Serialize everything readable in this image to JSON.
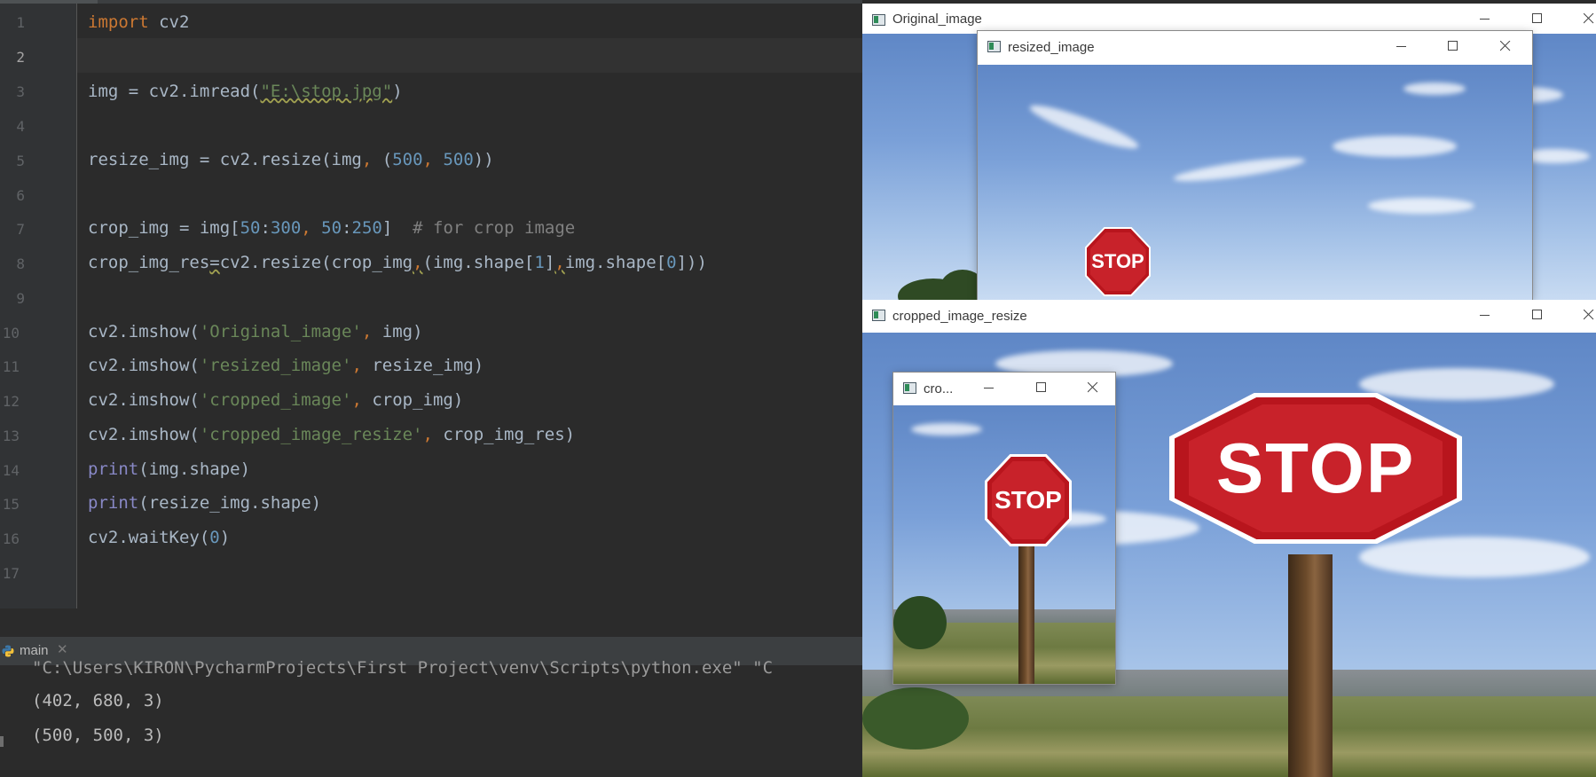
{
  "editor": {
    "current_line": 2,
    "lines": [
      {
        "n": "1"
      },
      {
        "n": "2"
      },
      {
        "n": "3"
      },
      {
        "n": "4"
      },
      {
        "n": "5"
      },
      {
        "n": "6"
      },
      {
        "n": "7"
      },
      {
        "n": "8"
      },
      {
        "n": "9"
      },
      {
        "n": "10"
      },
      {
        "n": "11"
      },
      {
        "n": "12"
      },
      {
        "n": "13"
      },
      {
        "n": "14"
      },
      {
        "n": "15"
      },
      {
        "n": "16"
      },
      {
        "n": "17"
      }
    ],
    "code": {
      "l1": {
        "kw": "import",
        "rest": " cv2"
      },
      "l3": {
        "a": "img = cv2.imread(",
        "s": "\"E:\\stop.jpg\"",
        "b": ")"
      },
      "l5": {
        "a": "resize_img = cv2.resize(img",
        "c1": ",",
        "sp": " (",
        "n1": "500",
        "c2": ",",
        "sp2": " ",
        "n2": "500",
        "b": "))"
      },
      "l7": {
        "a": "crop_img = img[",
        "n1": "50",
        "c1": ":",
        "n2": "300",
        "c2": ",",
        "sp": " ",
        "n3": "50",
        "c3": ":",
        "n4": "250",
        "b": "]  ",
        "cmt": "# for crop image"
      },
      "l8": {
        "a": "crop_img_res",
        "eq": "=",
        "b": "cv2.resize(crop_img",
        "c1": ",",
        "c": "(img.shape[",
        "n1": "1",
        "d": "]",
        "c2": ",",
        "e": "img.shape[",
        "n2": "0",
        "f": "]))"
      },
      "l10": {
        "a": "cv2.imshow(",
        "s": "'Original_image'",
        "c": ",",
        "b": " img)"
      },
      "l11": {
        "a": "cv2.imshow(",
        "s": "'resized_image'",
        "c": ",",
        "b": " resize_img)"
      },
      "l12": {
        "a": "cv2.imshow(",
        "s": "'cropped_image'",
        "c": ",",
        "b": " crop_img)"
      },
      "l13": {
        "a": "cv2.imshow(",
        "s": "'cropped_image_resize'",
        "c": ",",
        "b": " crop_img_res)"
      },
      "l14": {
        "bi": "print",
        "b": "(img.shape)"
      },
      "l15": {
        "bi": "print",
        "b": "(resize_img.shape)"
      },
      "l16": {
        "a": "cv2.waitKey(",
        "n": "0",
        "b": ")"
      }
    }
  },
  "run": {
    "tab_label": "main",
    "close_glyph": "✕",
    "output": [
      "\"C:\\Users\\KIRON\\PycharmProjects\\First Project\\venv\\Scripts\\python.exe\" \"C",
      "(402, 680, 3)",
      "(500, 500, 3)"
    ]
  },
  "windows": {
    "original": {
      "title": "Original_image"
    },
    "resized": {
      "title": "resized_image"
    },
    "cropped_resize": {
      "title": "cropped_image_resize"
    },
    "cropped": {
      "title": "cro..."
    }
  },
  "images": {
    "stop_text": "STOP"
  },
  "icons": {
    "minimize": "minimize-icon",
    "maximize": "maximize-icon",
    "close": "close-icon",
    "window": "opencv-window-icon",
    "python": "python-icon"
  },
  "colors": {
    "editor_bg": "#2b2b2b",
    "keyword": "#cc7832",
    "string": "#6a8759",
    "number": "#6897bb",
    "comment": "#808080",
    "builtin": "#8888c6",
    "stop_red": "#c8222a"
  }
}
